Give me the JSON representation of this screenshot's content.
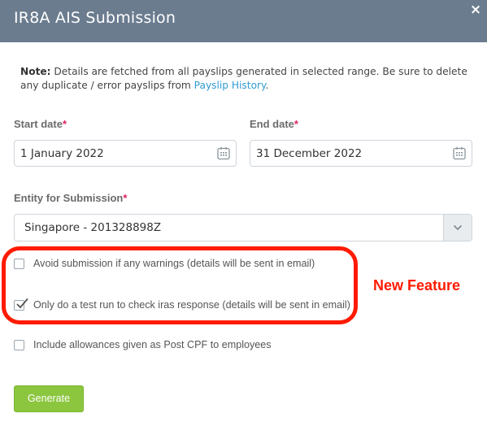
{
  "dialog": {
    "title": "IR8A AIS Submission",
    "close_glyph": "×"
  },
  "note": {
    "label": "Note:",
    "text": " Details are fetched from all payslips generated in selected range. Be sure to delete any duplicate / error payslips from ",
    "link": "Payslip History",
    "end": "."
  },
  "start_date": {
    "label": "Start date",
    "required_mark": "*",
    "value": "1 January 2022",
    "icon": "calendar-icon"
  },
  "end_date": {
    "label": "End date",
    "required_mark": "*",
    "value": "31 December 2022",
    "icon": "calendar-icon"
  },
  "entity": {
    "label": "Entity for Submission",
    "required_mark": "*",
    "value": "Singapore - 201328898Z",
    "icon": "chevron-down-icon"
  },
  "options": [
    {
      "label": "Avoid submission if any warnings (details will be sent in email)",
      "checked": false
    },
    {
      "label": "Only do a test run to check iras response (details will be sent in email)",
      "checked": true
    },
    {
      "label": "Include allowances given as Post CPF to employees",
      "checked": false
    }
  ],
  "annotation": {
    "text": "New Feature",
    "color": "#ff1a00"
  },
  "generate_button": {
    "label": "Generate",
    "color": "#8cc63f"
  },
  "colors": {
    "header": "#6b7c8f",
    "link": "#2f9bd3",
    "required": "#e0245e"
  }
}
